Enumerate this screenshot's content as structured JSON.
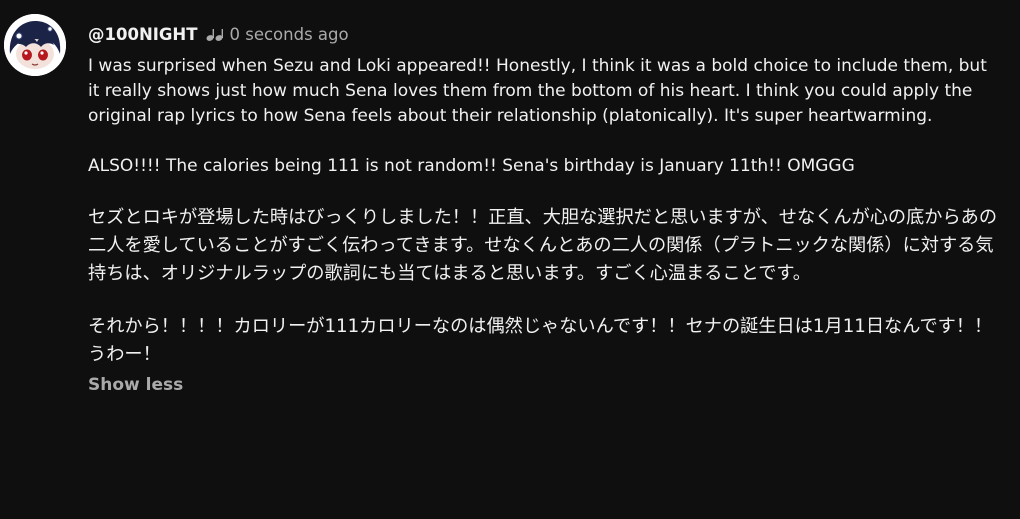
{
  "comment": {
    "author": "@100NIGHT",
    "badge_icon": "music-note-icon",
    "timestamp": "0 seconds ago",
    "paragraphs": [
      "I was surprised when Sezu and Loki appeared!! Honestly, I think it was a bold choice to include them, but it really shows just how much Sena loves them from the bottom of his heart. I think you could apply the original rap lyrics to how Sena feels about their relationship (platonically). It's super heartwarming.",
      "ALSO!!!! The calories being 111 is not random!! Sena's birthday is January 11th!! OMGGG",
      "セズとロキが登場した時はびっくりしました！！正直、大胆な選択だと思いますが、せなくんが心の底からあの二人を愛していることがすごく伝わってきます。せなくんとあの二人の関係（プラトニックな関係）に対する気持ちは、オリジナルラップの歌詞にも当てはまると思います。すごく心温まることです。",
      "それから！！！！カロリーが111カロリーなのは偶然じゃないんです！！セナの誕生日は1月11日なんです！！うわー！"
    ],
    "show_less_label": "Show less"
  },
  "colors": {
    "background": "#0f0f0f",
    "text": "#f1f1f1",
    "secondary_text": "#aaaaaa"
  }
}
